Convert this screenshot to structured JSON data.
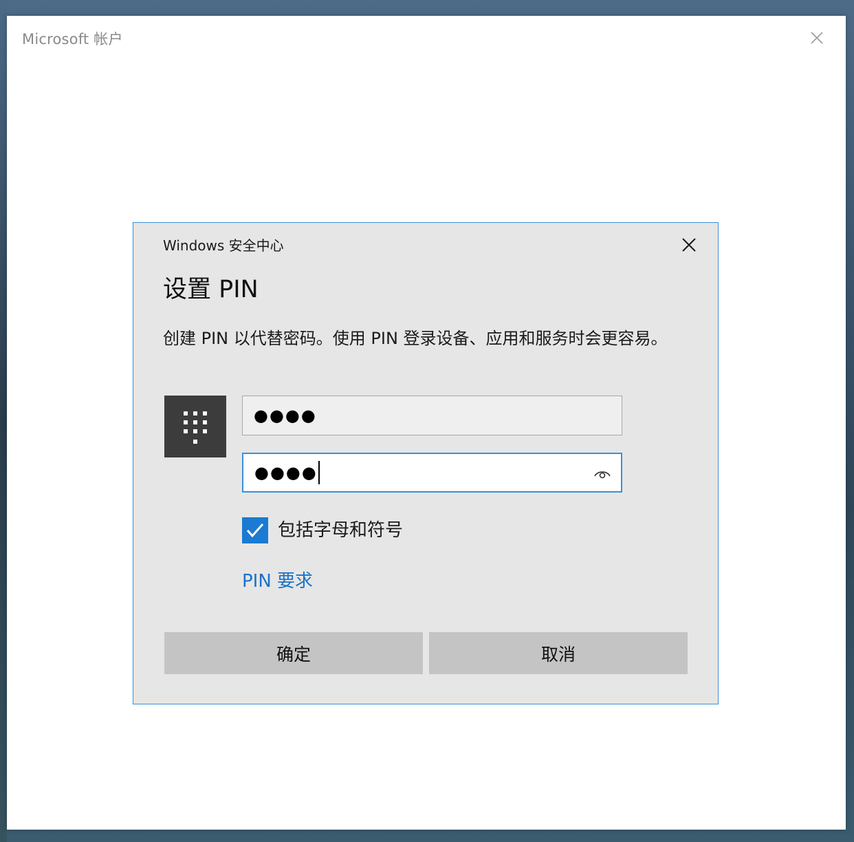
{
  "outer_window": {
    "title": "Microsoft 帐户"
  },
  "dialog": {
    "title": "Windows 安全中心",
    "heading": "设置 PIN",
    "description": "创建 PIN 以代替密码。使用 PIN 登录设备、应用和服务时会更容易。",
    "pin_field_value": "●●●●",
    "confirm_field_value": "●●●●",
    "include_letters_checked": true,
    "include_letters_label": "包括字母和符号",
    "pin_requirements_link": "PIN 要求",
    "ok_button": "确定",
    "cancel_button": "取消"
  },
  "colors": {
    "accent": "#1b7ad1",
    "link": "#1a73c8",
    "dialog_border": "#3c8fd6",
    "dialog_bg": "#e6e6e6",
    "button_bg": "#c4c4c4",
    "keypad_tile": "#3c3c3c"
  },
  "icons": {
    "outer_close": "close-icon",
    "dialog_close": "close-icon",
    "keypad": "keypad-icon",
    "reveal": "eye-icon",
    "checkbox": "checkmark-icon"
  }
}
